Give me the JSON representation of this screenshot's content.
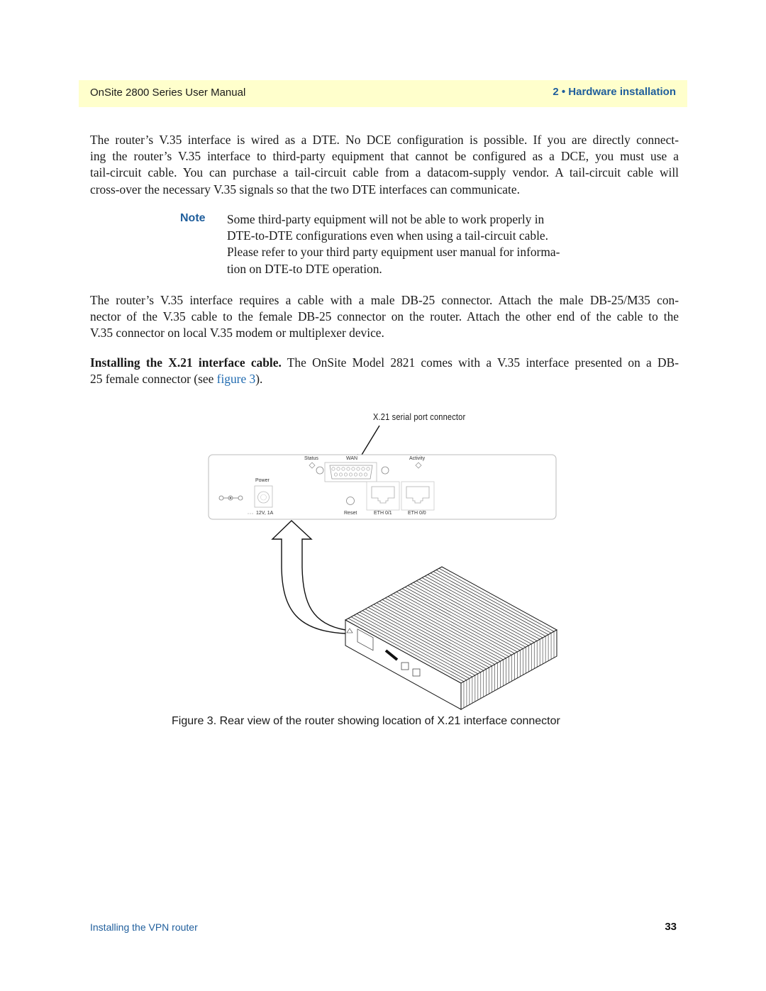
{
  "header": {
    "manual_title": "OnSite 2800 Series User Manual",
    "chapter": "2 • Hardware installation"
  },
  "body": {
    "para1_lines": [
      "The router’s V.35 interface is wired as a DTE. No DCE configuration is possible. If you are directly connect-",
      "ing the router’s V.35 interface to third-party equipment that cannot be configured as a DCE, you must use a",
      "tail-circuit cable. You can purchase a tail-circuit cable from a datacom-supply vendor. A tail-circuit cable will",
      "cross-over the necessary V.35 signals so that the two DTE interfaces can communicate."
    ],
    "note": {
      "label": "Note",
      "lines": [
        "Some third-party equipment will not be able to work properly in",
        "DTE-to-DTE configurations even when using a tail-circuit cable.",
        "Please refer to your third party equipment user manual for informa-",
        "tion on DTE-to DTE operation."
      ]
    },
    "para2_lines": [
      "The router’s V.35 interface requires a cable with a male DB-25 connector. Attach the male DB-25/M35 con-",
      "nector of the V.35 cable to the female DB-25 connector on the router. Attach the other end of the cable to the",
      "V.35 connector on local V.35 modem or multiplexer device."
    ],
    "para3": {
      "heading": "Installing the X.21 interface cable.",
      "line1_rest": " The OnSite Model 2821 comes with a V.35 interface presented on a DB-",
      "line2_before": "25 female connector (see ",
      "link_text": "figure 3",
      "line2_after": ")."
    }
  },
  "figure": {
    "callout_label": "X.21 serial port connector",
    "panel_labels": {
      "status": "Status",
      "wan": "WAN",
      "activity": "Activity",
      "power": "Power",
      "power_rating": "12V, 1A",
      "reset": "Reset",
      "eth01": "ETH 0/1",
      "eth00": "ETH 0/0"
    },
    "caption": "Figure 3. Rear view of the router showing location of X.21 interface connector"
  },
  "footer": {
    "section": "Installing the VPN router",
    "page_number": "33"
  }
}
